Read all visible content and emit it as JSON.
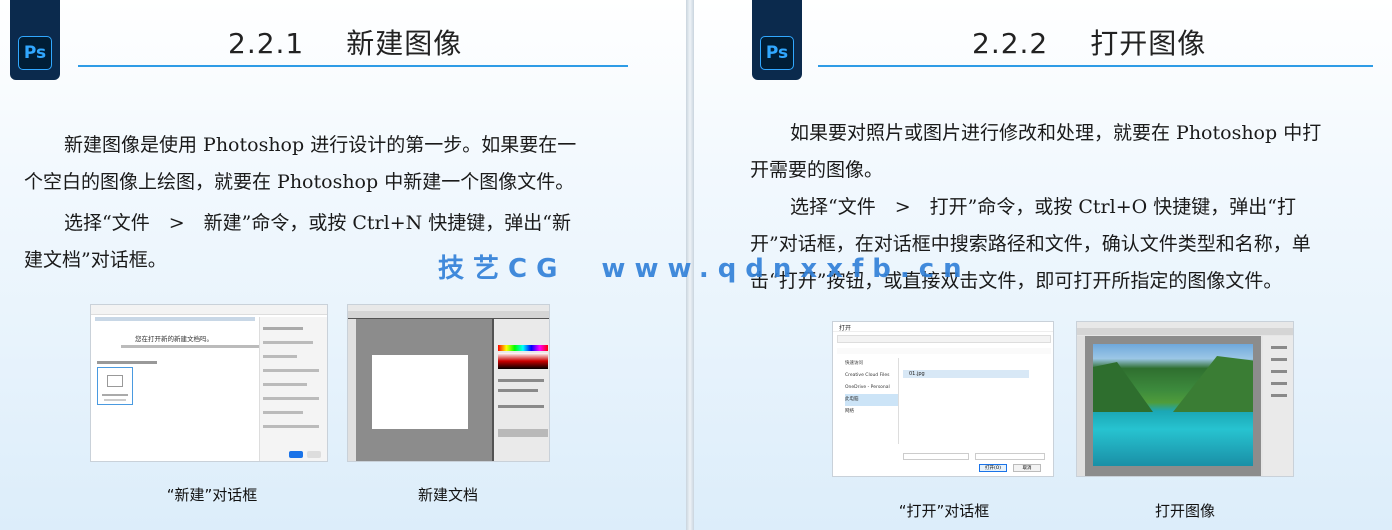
{
  "left": {
    "logo_text": "Ps",
    "section_number": "2.2.1",
    "section_title": "新建图像",
    "paragraphs": [
      {
        "lines": [
          "新建图像是使用 Photoshop 进行设计的第一步。如果要在一",
          "个空白的图像上绘图，就要在 Photoshop 中新建一个图像文件。"
        ]
      },
      {
        "lines": [
          "选择“文件　>　新建”命令，或按 Ctrl+N 快捷键，弹出“新",
          "建文档”对话框。"
        ]
      }
    ],
    "figures": [
      {
        "caption": "“新建”对话框",
        "dialog_heading": "您在打开新的新建文档吗。"
      },
      {
        "caption": "新建文档"
      }
    ]
  },
  "right": {
    "logo_text": "Ps",
    "section_number": "2.2.2",
    "section_title": "打开图像",
    "paragraphs": [
      {
        "lines": [
          "如果要对照片或图片进行修改和处理，就要在 Photoshop 中打",
          "开需要的图像。"
        ]
      },
      {
        "lines": [
          "选择“文件　>　打开”命令，或按 Ctrl+O 快捷键，弹出“打",
          "开”对话框，在对话框中搜索路径和文件，确认文件类型和名称，单",
          "击“打开”按钮，或直接双击文件，即可打开所指定的图像文件。"
        ]
      }
    ],
    "figures": [
      {
        "caption": "“打开”对话框",
        "dialog_title": "打开",
        "open_button": "打开(O)",
        "cancel_button": "取消",
        "nav_items": [
          "快速访问",
          "Creative Cloud Files",
          "OneDrive - Personal",
          "此电脑",
          "网络"
        ],
        "file_name": "01.jpg"
      },
      {
        "caption": "打开图像"
      }
    ]
  },
  "watermark": "技艺CG　www.qdnxxfb.cn",
  "colors": {
    "accent": "#2e9ce6",
    "ps_blue": "#31a8ff",
    "ps_dark": "#001e36",
    "watermark": "#2f7fd8"
  }
}
